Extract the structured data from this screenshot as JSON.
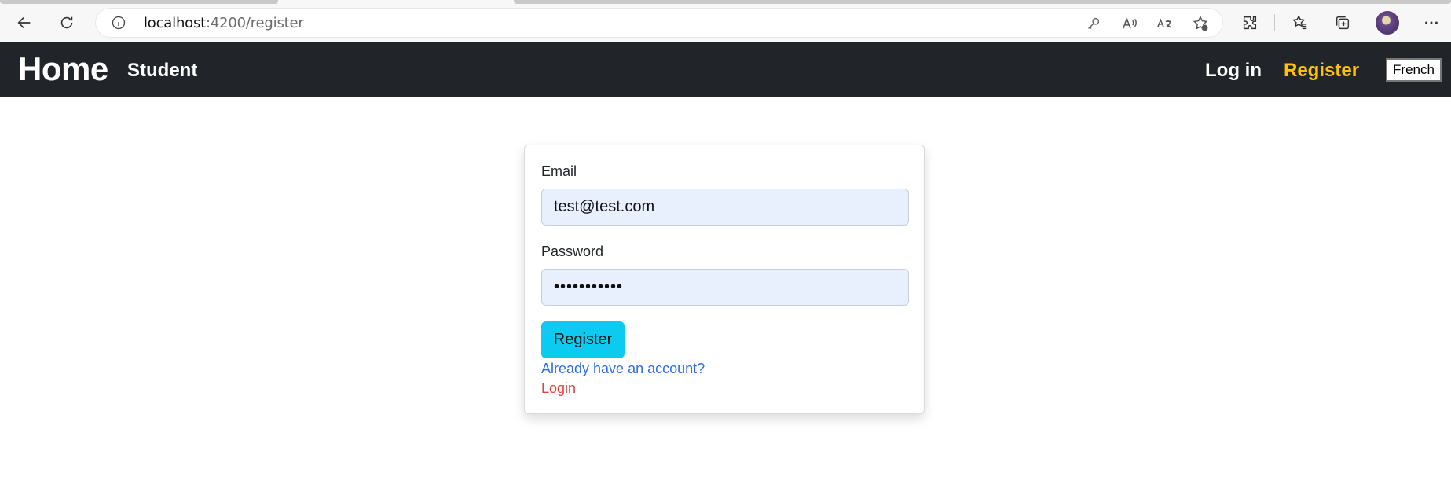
{
  "browser": {
    "url_host": "localhost",
    "url_path": ":4200/register",
    "icons": [
      "back-arrow-icon",
      "refresh-icon",
      "info-icon",
      "key-icon",
      "read-aloud-icon",
      "translate-icon",
      "favorite-add-icon",
      "extensions-icon",
      "favorites-icon",
      "collections-icon",
      "profile-avatar",
      "more-icon"
    ]
  },
  "navbar": {
    "brand": "Home",
    "student": "Student",
    "login": "Log in",
    "register": "Register",
    "language": "French",
    "colors": {
      "background": "#212529",
      "active": "#ffc107"
    }
  },
  "form": {
    "email_label": "Email",
    "email_value": "test@test.com",
    "password_label": "Password",
    "password_value": "•••••••••••",
    "submit": "Register",
    "account_prompt": "Already have an account?",
    "login_link": "Login",
    "colors": {
      "submit": "#0dcaf0",
      "prompt": "#2b6fe3",
      "login": "#d9453d",
      "input_bg": "#e8f0fe"
    }
  }
}
